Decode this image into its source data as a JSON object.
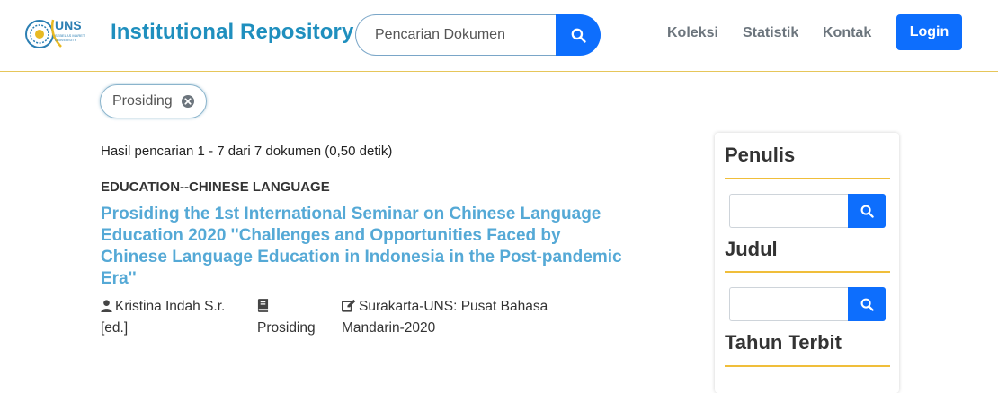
{
  "header": {
    "brand": "Institutional Repository",
    "logo_text": "UNS",
    "logo_subtext": "SEBELAS MARET UNIVERSITY",
    "search_placeholder": "Pencarian Dokumen",
    "nav": [
      "Koleksi",
      "Statistik",
      "Kontak"
    ],
    "login_label": "Login"
  },
  "filter_chip": {
    "label": "Prosiding"
  },
  "results": {
    "summary": "Hasil pencarian 1 - 7 dari 7 dokumen (0,50 detik)",
    "items": [
      {
        "subject": "EDUCATION--CHINESE LANGUAGE",
        "title": "Prosiding the 1st International Seminar on Chinese Language Education 2020 ''Challenges and Opportunities Faced by Chinese Language Education in Indonesia in the Post-pandemic Era''",
        "author_line1": "Kristina Indah S.r.",
        "author_line2": "[ed.]",
        "type": "Prosiding",
        "publisher_line1": "Surakarta-UNS: Pusat Bahasa",
        "publisher_line2": "Mandarin-2020"
      }
    ]
  },
  "sidebar": {
    "sections": [
      "Penulis",
      "Judul",
      "Tahun Terbit"
    ]
  },
  "colors": {
    "primary": "#0d6efd",
    "brand": "#1f8fbe",
    "title_link": "#55a9d6",
    "accent_rule": "#f0be3a"
  },
  "icons": [
    "uns-logo",
    "search-icon",
    "close-circle-icon",
    "user-icon",
    "book-icon",
    "edit-icon"
  ]
}
